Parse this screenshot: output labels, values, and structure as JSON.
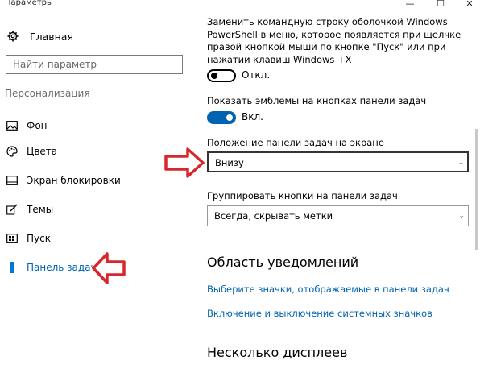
{
  "window": {
    "title": "Параметры",
    "minimize_glyph": "—",
    "maximize_glyph": "☐",
    "close_glyph": "✕"
  },
  "sidebar": {
    "home_label": "Главная",
    "search_placeholder": "Найти параметр",
    "section_title": "Персонализация",
    "items": [
      {
        "label": "Фон",
        "icon": "picture-icon"
      },
      {
        "label": "Цвета",
        "icon": "palette-icon"
      },
      {
        "label": "Экран блокировки",
        "icon": "lock-screen-icon"
      },
      {
        "label": "Темы",
        "icon": "brush-icon"
      },
      {
        "label": "Пуск",
        "icon": "start-icon"
      },
      {
        "label": "Панель задач",
        "icon": "taskbar-icon",
        "active": true
      }
    ]
  },
  "main": {
    "powershell_desc": "Заменить командную строку оболочкой Windows PowerShell в меню, которое появляется при щелчке правой кнопкой мыши по кнопке \"Пуск\" или при нажатии клавиш Windows +X",
    "powershell_toggle": "Откл.",
    "badges_desc": "Показать эмблемы на кнопках панели задач",
    "badges_toggle": "Вкл.",
    "position_label": "Положение панели задач на экране",
    "position_value": "Внизу",
    "group_label": "Группировать кнопки на панели задач",
    "group_value": "Всегда, скрывать метки",
    "notifications_heading": "Область уведомлений",
    "link_icons": "Выберите значки, отображаемые в панели задач",
    "link_system_icons": "Включение и выключение системных значков",
    "displays_heading": "Несколько дисплеев"
  },
  "colors": {
    "accent": "#0063b1",
    "annotation_arrow": "#d9262c"
  }
}
